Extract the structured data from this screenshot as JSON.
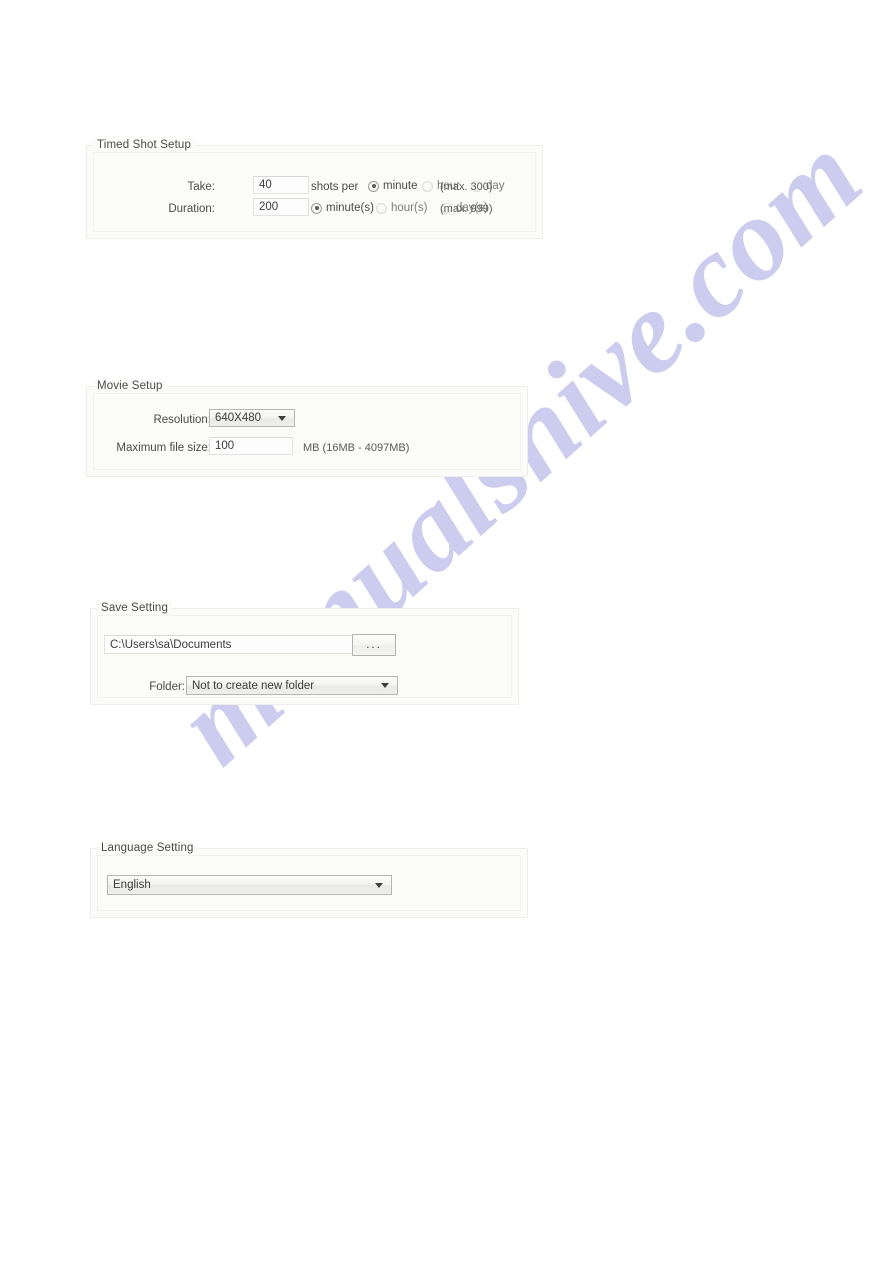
{
  "watermark": {
    "text": "manualshive.com",
    "color": "#b9b9e8"
  },
  "panels": {
    "timed_shot": {
      "title": "Timed Shot Setup",
      "take": {
        "label": "Take:",
        "value": "40",
        "suffix": "shots per",
        "max_hint": "(max. 300)",
        "options": [
          {
            "label": "minute",
            "checked": true
          },
          {
            "label": "hour",
            "checked": false
          },
          {
            "label": "day",
            "checked": false
          }
        ]
      },
      "duration": {
        "label": "Duration:",
        "value": "200",
        "max_hint": "(max. 999)",
        "options": [
          {
            "label": "minute(s)",
            "checked": true
          },
          {
            "label": "hour(s)",
            "checked": false
          },
          {
            "label": "day(s)",
            "checked": false
          }
        ]
      }
    },
    "movie_setup": {
      "title": "Movie Setup",
      "resolution": {
        "label": "Resolution:",
        "value": "640X480"
      },
      "max_file_size": {
        "label": "Maximum file size:",
        "value": "100",
        "unit_hint": "MB (16MB - 4097MB)"
      }
    },
    "save_setting": {
      "title": "Save Setting",
      "path": {
        "value": "C:\\Users\\sa\\Documents"
      },
      "browse_button": {
        "label": "..."
      },
      "folder": {
        "label": "Folder:",
        "value": "Not to create new folder"
      }
    },
    "language_setting": {
      "title": "Language Setting",
      "language": {
        "value": "English"
      }
    }
  }
}
